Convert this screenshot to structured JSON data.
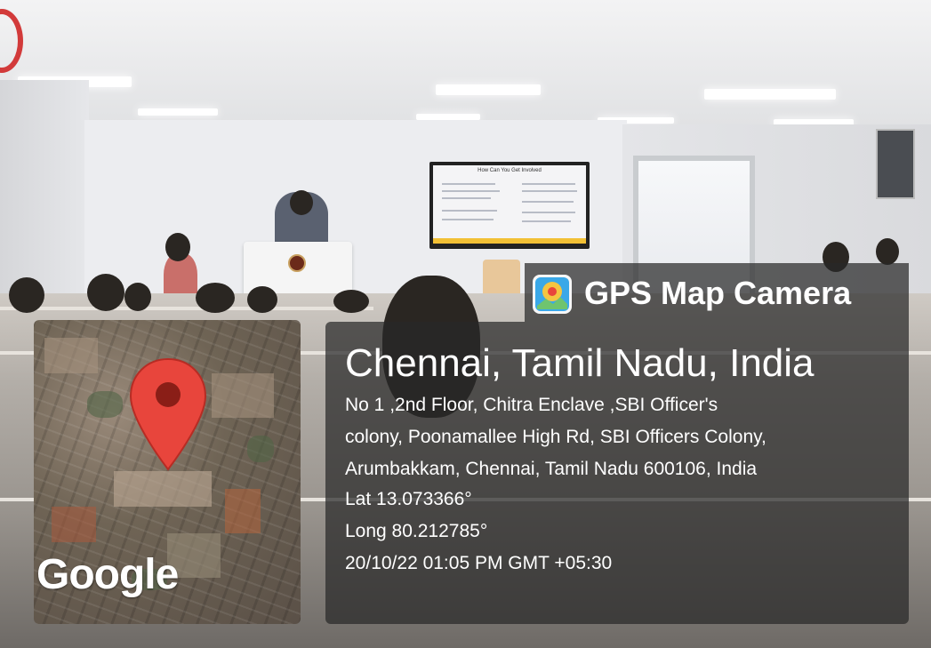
{
  "app": {
    "name": "GPS Map Camera",
    "icon": "gps-map-camera-icon",
    "accent": "#ffffff"
  },
  "map": {
    "watermark": "Google",
    "pin_icon": "map-pin-icon",
    "pin_color": "#e8453c"
  },
  "location": {
    "city": "Chennai, Tamil Nadu, India",
    "address_lines": [
      "No 1 ,2nd Floor, Chitra Enclave ,SBI Officer's",
      "colony, Poonamallee High Rd, SBI Officers Colony,",
      "Arumbakkam, Chennai, Tamil Nadu 600106, India"
    ],
    "lat": "Lat 13.073366°",
    "long": "Long 80.212785°",
    "datetime": "20/10/22 01:05 PM GMT +05:30"
  },
  "slide": {
    "title": "How Can You Get Involved"
  }
}
